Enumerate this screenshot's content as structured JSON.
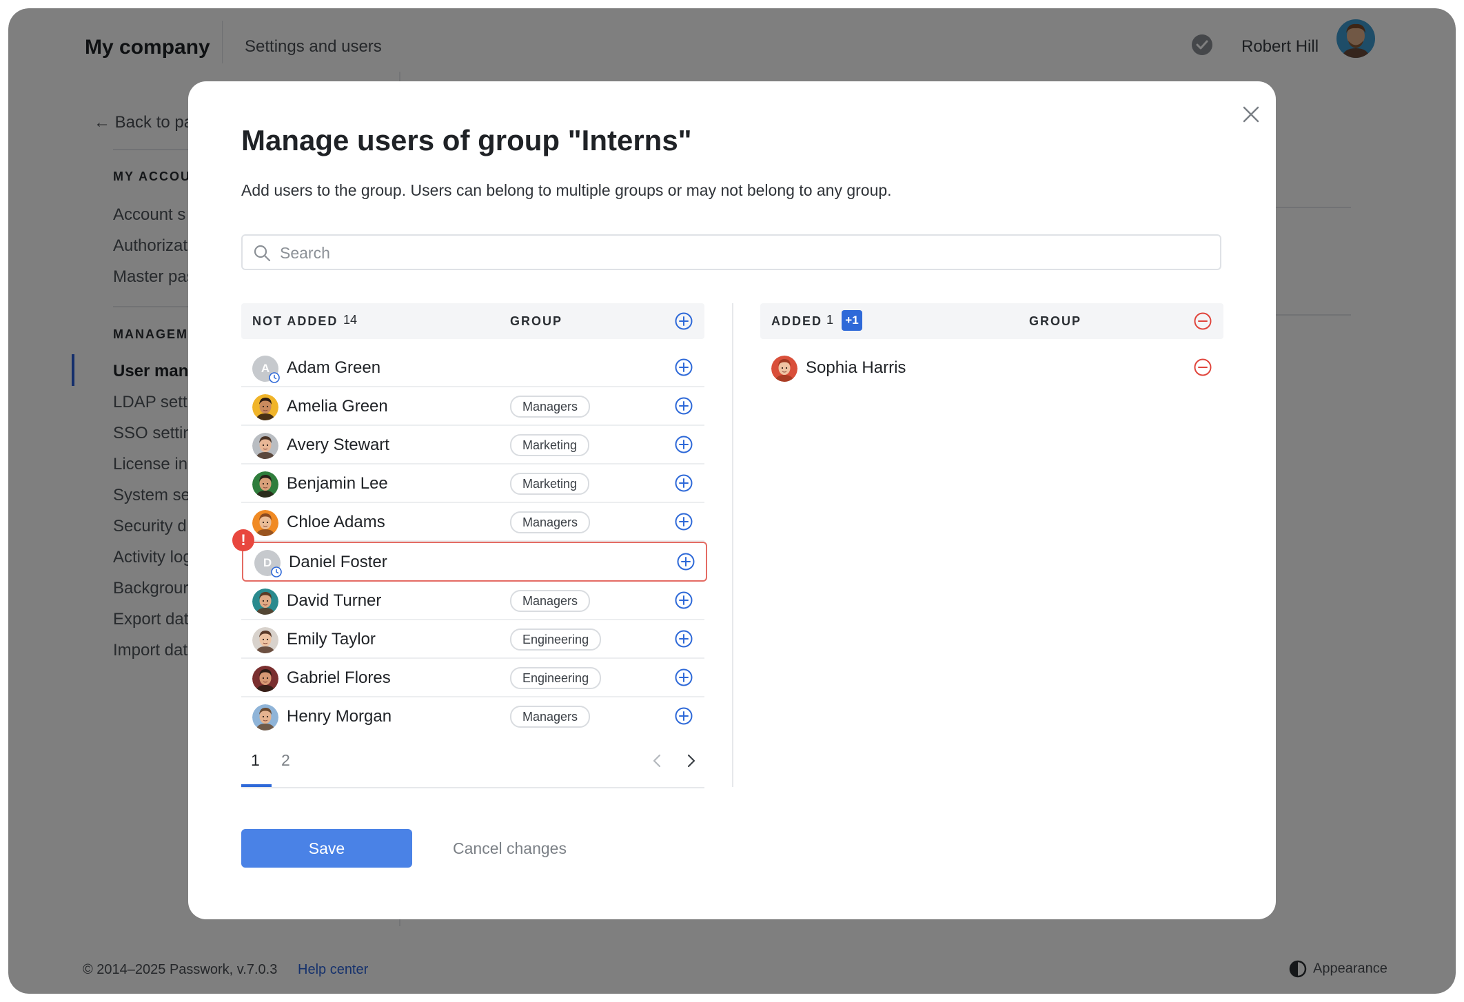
{
  "topbar": {
    "brand": "My company",
    "section": "Settings and users",
    "user_name": "Robert Hill"
  },
  "sidebar": {
    "back_label": "Back to pa",
    "group1_heading": "MY ACCOU",
    "group1_items": [
      "Account s",
      "Authorizat",
      "Master pas"
    ],
    "group2_heading": "MANAGEM",
    "group2_items": [
      "User mana",
      "LDAP setti",
      "SSO settin",
      "License in",
      "System se",
      "Security d",
      "Activity log",
      "Backgrour",
      "Export dat",
      "Import dat"
    ],
    "active_index": 0
  },
  "footer": {
    "copyright": "© 2014–2025 Passwork, v.7.0.3",
    "help": "Help center",
    "appearance": "Appearance"
  },
  "modal": {
    "title": "Manage users of group \"Interns\"",
    "description": "Add users to the group. Users can belong to multiple groups or may not belong to any group.",
    "search_placeholder": "Search",
    "save_label": "Save",
    "cancel_label": "Cancel changes",
    "not_added": {
      "label": "NOT ADDED",
      "count": "14",
      "group_header": "GROUP",
      "rows": [
        {
          "name": "Adam Green",
          "group": "",
          "avatar": "placeholder",
          "initial": "A",
          "pending": true,
          "error": false
        },
        {
          "name": "Amelia Green",
          "group": "Managers",
          "avatar": "face",
          "skin": "#c98a5e",
          "hair": "#2b1a12",
          "bg": "#f0b429",
          "error": false
        },
        {
          "name": "Avery Stewart",
          "group": "Marketing",
          "avatar": "face",
          "skin": "#e8b796",
          "hair": "#4a3426",
          "bg": "#b9bdc2",
          "error": false
        },
        {
          "name": "Benjamin Lee",
          "group": "Marketing",
          "avatar": "face",
          "skin": "#d9a07a",
          "hair": "#2a1f18",
          "bg": "#2f7d3c",
          "error": false
        },
        {
          "name": "Chloe Adams",
          "group": "Managers",
          "avatar": "face",
          "skin": "#eabd97",
          "hair": "#8a4a20",
          "bg": "#f08a24",
          "error": false
        },
        {
          "name": "Daniel Foster",
          "group": "",
          "avatar": "placeholder",
          "initial": "D",
          "pending": true,
          "error": true,
          "error_mark": "!"
        },
        {
          "name": "David Turner",
          "group": "Managers",
          "avatar": "face",
          "skin": "#e0aa86",
          "hair": "#5a3a24",
          "bg": "#2a8a8e",
          "error": false
        },
        {
          "name": "Emily Taylor",
          "group": "Engineering",
          "avatar": "face",
          "skin": "#eec3a2",
          "hair": "#5b3a28",
          "bg": "#d8d2cc",
          "error": false
        },
        {
          "name": "Gabriel Flores",
          "group": "Engineering",
          "avatar": "face",
          "skin": "#d69a74",
          "hair": "#2b1c14",
          "bg": "#7a2f2f",
          "error": false
        },
        {
          "name": "Henry Morgan",
          "group": "Managers",
          "avatar": "face",
          "skin": "#e5b38f",
          "hair": "#6b4a30",
          "bg": "#8fb4d8",
          "error": false
        }
      ]
    },
    "added": {
      "label": "ADDED",
      "count": "1",
      "badge": "+1",
      "group_header": "GROUP",
      "rows": [
        {
          "name": "Sophia Harris",
          "group": "",
          "avatar": "face",
          "skin": "#efc4a4",
          "hair": "#a13a22",
          "bg": "#d94f3a"
        }
      ]
    },
    "pagination": {
      "pages": [
        "1",
        "2"
      ],
      "current": "1"
    }
  },
  "colors": {
    "accent": "#2e69d8",
    "save": "#4a82e6",
    "remove": "#e0453c",
    "error": "#e8473e"
  }
}
